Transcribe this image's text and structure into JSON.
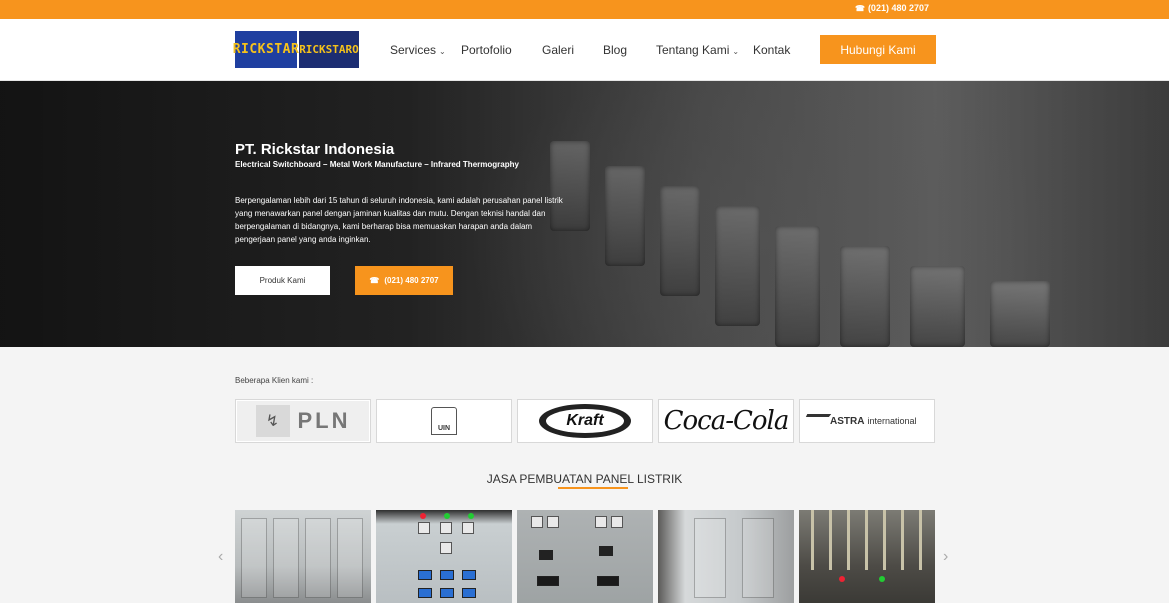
{
  "topbar": {
    "phone": "(021) 480 2707",
    "phone_icon": "phone-icon"
  },
  "logo": {
    "part1": "RICKSTAR",
    "part2": "RICKSTARO"
  },
  "nav": {
    "items": [
      {
        "label": "Services",
        "has_dropdown": true
      },
      {
        "label": "Portofolio",
        "has_dropdown": false
      },
      {
        "label": "Galeri",
        "has_dropdown": false
      },
      {
        "label": "Blog",
        "has_dropdown": false
      },
      {
        "label": "Tentang Kami",
        "has_dropdown": true
      },
      {
        "label": "Kontak",
        "has_dropdown": false
      }
    ],
    "cta": "Hubungi Kami"
  },
  "hero": {
    "title": "PT. Rickstar Indonesia",
    "subtitle": "Electrical Switchboard – Metal Work Manufacture – Infrared Thermography",
    "description": "Berpengalaman lebih dari 15 tahun di seluruh indonesia, kami adalah perusahan panel listrik yang menawarkan panel dengan jaminan kualitas dan mutu. Dengan teknisi handal dan berpengalaman di bidangnya, kami berharap bisa memuaskan harapan anda dalam pengerjaan panel yang anda inginkan.",
    "btn_products": "Produk Kami",
    "btn_phone": "(021) 480 2707"
  },
  "clients": {
    "label": "Beberapa Klien kami :",
    "logos": {
      "pln": "PLN",
      "uin": "UIN",
      "kraft": "Kraft",
      "cocacola": "Coca-Cola",
      "astra": "ASTRA",
      "astra_suffix": "international"
    }
  },
  "services": {
    "title": "JASA PEMBUATAN PANEL LISTRIK",
    "prev": "‹",
    "next": "›"
  },
  "colors": {
    "accent": "#f7941d",
    "logo_blue": "#1f3fa0",
    "logo_yellow": "#f5c21b"
  }
}
